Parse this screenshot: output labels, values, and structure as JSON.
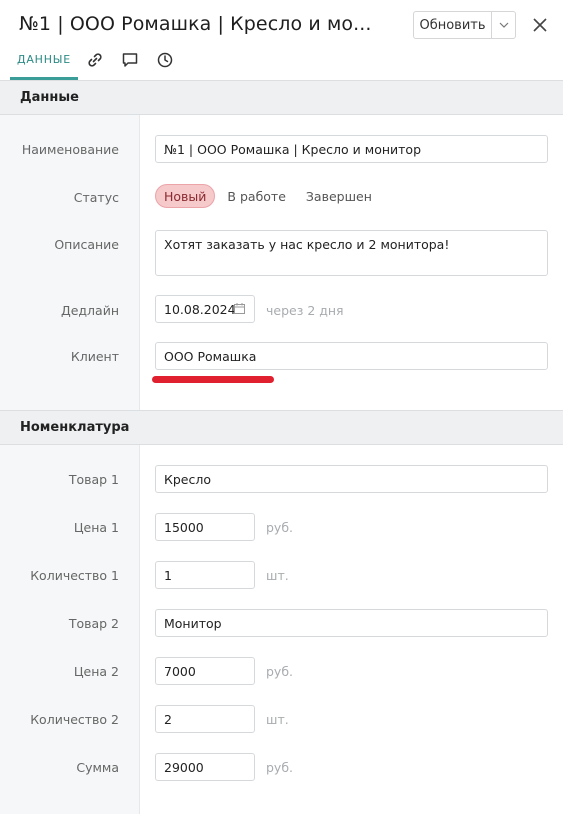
{
  "header": {
    "title": "№1 | ООО Ромашка | Кресло и мо...",
    "update_label": "Обновить"
  },
  "tabs": {
    "data_label": "ДАННЫЕ",
    "icons": [
      "link-icon",
      "comment-icon",
      "history-icon"
    ]
  },
  "section_data": {
    "title": "Данные",
    "name_label": "Наименование",
    "name_value": "№1 | ООО Ромашка | Кресло и монитор",
    "status_label": "Статус",
    "status_options": [
      "Новый",
      "В работе",
      "Завершен"
    ],
    "status_selected": "Новый",
    "description_label": "Описание",
    "description_value": "Хотят заказать у нас кресло и 2 монитора!",
    "deadline_label": "Дедлайн",
    "deadline_value": "10.08.2024",
    "deadline_hint": "через 2 дня",
    "client_label": "Клиент",
    "client_value": "ООО Ромашка"
  },
  "section_nomenclature": {
    "title": "Номенклатура",
    "item1_label": "Товар 1",
    "item1_value": "Кресло",
    "price1_label": "Цена 1",
    "price1_value": "15000",
    "price1_unit": "руб.",
    "qty1_label": "Количество 1",
    "qty1_value": "1",
    "qty1_unit": "шт.",
    "item2_label": "Товар 2",
    "item2_value": "Монитор",
    "price2_label": "Цена 2",
    "price2_value": "7000",
    "price2_unit": "руб.",
    "qty2_label": "Количество 2",
    "qty2_value": "2",
    "qty2_unit": "шт.",
    "sum_label": "Сумма",
    "sum_value": "29000",
    "sum_unit": "руб."
  },
  "colors": {
    "accent": "#3a9d97",
    "status_active_bg": "#f6c9cb",
    "annotation_underline": "#e0202f"
  }
}
